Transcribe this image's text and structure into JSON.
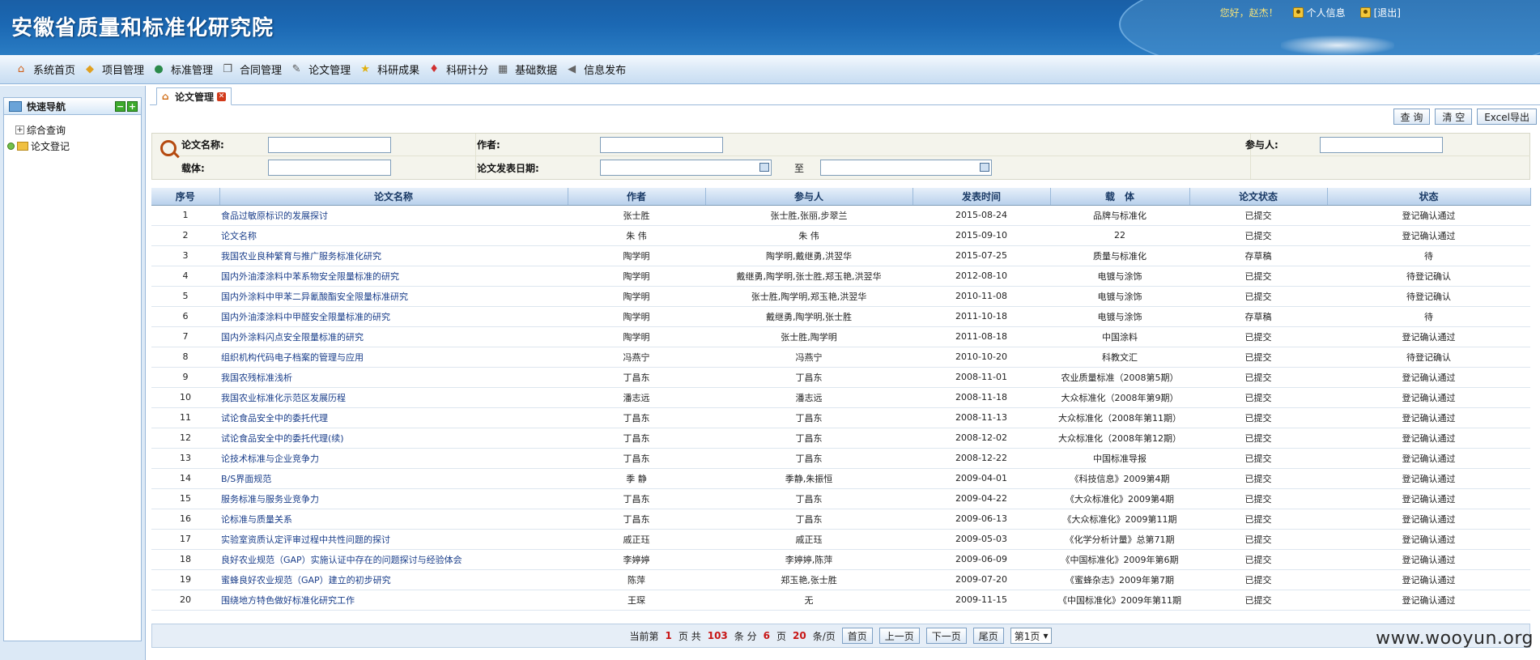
{
  "header": {
    "title": "安徽省质量和标准化研究院",
    "greeting": "您好，赵杰！",
    "links": [
      {
        "label": "个人信息"
      },
      {
        "label": "[退出]"
      }
    ]
  },
  "menu": [
    {
      "label": "系统首页",
      "icon": "home-icon",
      "glyph": "⌂",
      "color": "#d0601a"
    },
    {
      "label": "项目管理",
      "icon": "box-icon",
      "glyph": "◆",
      "color": "#e0a020"
    },
    {
      "label": "标准管理",
      "icon": "globe-icon",
      "glyph": "●",
      "color": "#2a8a4a"
    },
    {
      "label": "合同管理",
      "icon": "copy-icon",
      "glyph": "❐",
      "color": "#555555"
    },
    {
      "label": "论文管理",
      "icon": "document-icon",
      "glyph": "✎",
      "color": "#555555"
    },
    {
      "label": "科研成果",
      "icon": "star-icon",
      "glyph": "★",
      "color": "#e0b010"
    },
    {
      "label": "科研计分",
      "icon": "gem-icon",
      "glyph": "♦",
      "color": "#d03030"
    },
    {
      "label": "基础数据",
      "icon": "grid-icon",
      "glyph": "▦",
      "color": "#555555"
    },
    {
      "label": "信息发布",
      "icon": "arrow-icon",
      "glyph": "◀",
      "color": "#666666"
    }
  ],
  "sidebar": {
    "title": "快速导航",
    "items": [
      {
        "label": "综合查询"
      },
      {
        "label": "论文登记"
      }
    ]
  },
  "tab": {
    "label": "论文管理"
  },
  "actions": {
    "query": "查 询",
    "clear": "清 空",
    "export": "Excel导出"
  },
  "search": {
    "name_label": "论文名称:",
    "author_label": "作者:",
    "participant_label": "参与人:",
    "carrier_label": "载体:",
    "date_label": "论文发表日期:",
    "to_label": "至",
    "name_value": "",
    "author_value": "",
    "participant_value": "",
    "carrier_value": "",
    "date_from": "",
    "date_to": ""
  },
  "table": {
    "columns": [
      "序号",
      "论文名称",
      "作者",
      "参与人",
      "发表时间",
      "载　体",
      "论文状态",
      "状态"
    ],
    "rows": [
      [
        "1",
        "食品过敏原标识的发展探讨",
        "张士胜",
        "张士胜,张丽,步翠兰",
        "2015-08-24",
        "品牌与标准化",
        "已提交",
        "登记确认通过"
      ],
      [
        "2",
        "论文名称",
        "朱 伟",
        "朱 伟",
        "2015-09-10",
        "22",
        "已提交",
        "登记确认通过"
      ],
      [
        "3",
        "我国农业良种繁育与推广服务标准化研究",
        "陶学明",
        "陶学明,戴继勇,洪翌华",
        "2015-07-25",
        "质量与标准化",
        "存草稿",
        "待"
      ],
      [
        "4",
        "国内外油漆涂料中苯系物安全限量标准的研究",
        "陶学明",
        "戴继勇,陶学明,张士胜,郑玉艳,洪翌华",
        "2012-08-10",
        "电镀与涂饰",
        "已提交",
        "待登记确认"
      ],
      [
        "5",
        "国内外涂料中甲苯二异氰酸酯安全限量标准研究",
        "陶学明",
        "张士胜,陶学明,郑玉艳,洪翌华",
        "2010-11-08",
        "电镀与涂饰",
        "已提交",
        "待登记确认"
      ],
      [
        "6",
        "国内外油漆涂料中甲醛安全限量标准的研究",
        "陶学明",
        "戴继勇,陶学明,张士胜",
        "2011-10-18",
        "电镀与涂饰",
        "存草稿",
        "待"
      ],
      [
        "7",
        "国内外涂料闪点安全限量标准的研究",
        "陶学明",
        "张士胜,陶学明",
        "2011-08-18",
        "中国涂料",
        "已提交",
        "登记确认通过"
      ],
      [
        "8",
        "组织机构代码电子档案的管理与应用",
        "冯燕宁",
        "冯燕宁",
        "2010-10-20",
        "科教文汇",
        "已提交",
        "待登记确认"
      ],
      [
        "9",
        "我国农残标准浅析",
        "丁昌东",
        "丁昌东",
        "2008-11-01",
        "农业质量标准（2008第5期）",
        "已提交",
        "登记确认通过"
      ],
      [
        "10",
        "我国农业标准化示范区发展历程",
        "潘志远",
        "潘志远",
        "2008-11-18",
        "大众标准化（2008年第9期）",
        "已提交",
        "登记确认通过"
      ],
      [
        "11",
        "试论食品安全中的委托代理",
        "丁昌东",
        "丁昌东",
        "2008-11-13",
        "大众标准化（2008年第11期）",
        "已提交",
        "登记确认通过"
      ],
      [
        "12",
        "试论食品安全中的委托代理(续)",
        "丁昌东",
        "丁昌东",
        "2008-12-02",
        "大众标准化（2008年第12期）",
        "已提交",
        "登记确认通过"
      ],
      [
        "13",
        "论技术标准与企业竞争力",
        "丁昌东",
        "丁昌东",
        "2008-12-22",
        "中国标准导报",
        "已提交",
        "登记确认通过"
      ],
      [
        "14",
        "B/S界面规范",
        "季 静",
        "季静,朱振恒",
        "2009-04-01",
        "《科技信息》2009第4期",
        "已提交",
        "登记确认通过"
      ],
      [
        "15",
        "服务标准与服务业竞争力",
        "丁昌东",
        "丁昌东",
        "2009-04-22",
        "《大众标准化》2009第4期",
        "已提交",
        "登记确认通过"
      ],
      [
        "16",
        "论标准与质量关系",
        "丁昌东",
        "丁昌东",
        "2009-06-13",
        "《大众标准化》2009第11期",
        "已提交",
        "登记确认通过"
      ],
      [
        "17",
        "实验室资质认定评审过程中共性问题的探讨",
        "戚正珏",
        "戚正珏",
        "2009-05-03",
        "《化学分析计量》总第71期",
        "已提交",
        "登记确认通过"
      ],
      [
        "18",
        "良好农业规范（GAP）实施认证中存在的问题探讨与经验体会",
        "李婷婷",
        "李婷婷,陈萍",
        "2009-06-09",
        "《中国标准化》2009年第6期",
        "已提交",
        "登记确认通过"
      ],
      [
        "19",
        "蜜蜂良好农业规范（GAP）建立的初步研究",
        "陈萍",
        "郑玉艳,张士胜",
        "2009-07-20",
        "《蜜蜂杂志》2009年第7期",
        "已提交",
        "登记确认通过"
      ],
      [
        "20",
        "围绕地方特色做好标准化研究工作",
        "王琛",
        "无",
        "2009-11-15",
        "《中国标准化》2009年第11期",
        "已提交",
        "登记确认通过"
      ]
    ]
  },
  "pager": {
    "text_current_prefix": "当前第",
    "current": "1",
    "text_page_total": "页 共",
    "total": "103",
    "text_items_split": "条 分",
    "pages": "6",
    "text_pages": "页",
    "per_page": "20",
    "text_per_page": "条/页",
    "first": "首页",
    "prev": "上一页",
    "next": "下一页",
    "last": "尾页",
    "select_value": "第1页"
  },
  "watermark": "www.wooyun.org"
}
